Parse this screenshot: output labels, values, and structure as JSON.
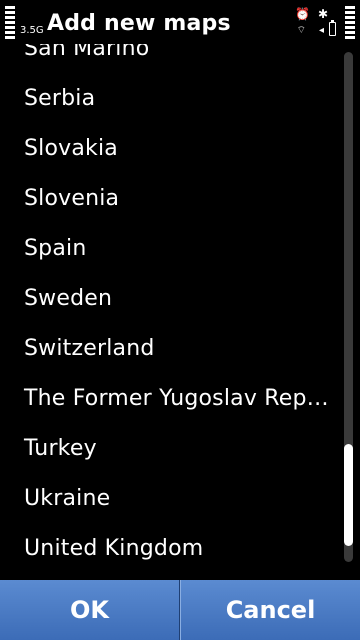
{
  "header": {
    "title": "Add new maps",
    "network": "3.5G",
    "status_icons": [
      "alarm-icon",
      "bluetooth-icon",
      "wlan-icon",
      "gps-icon",
      "battery-icon"
    ]
  },
  "list": {
    "items": [
      "San Marino",
      "Serbia",
      "Slovakia",
      "Slovenia",
      "Spain",
      "Sweden",
      "Switzerland",
      "The Former Yugoslav Repu...",
      "Turkey",
      "Ukraine",
      "United Kingdom"
    ]
  },
  "scrollbar": {
    "position_fraction": 0.96,
    "visible_fraction": 0.2
  },
  "softkeys": {
    "ok_label": "OK",
    "cancel_label": "Cancel"
  },
  "colors": {
    "background": "#000000",
    "softkey_blue": "#4a7bc6",
    "scroll_track": "#3a3a3a",
    "text": "#ffffff"
  }
}
